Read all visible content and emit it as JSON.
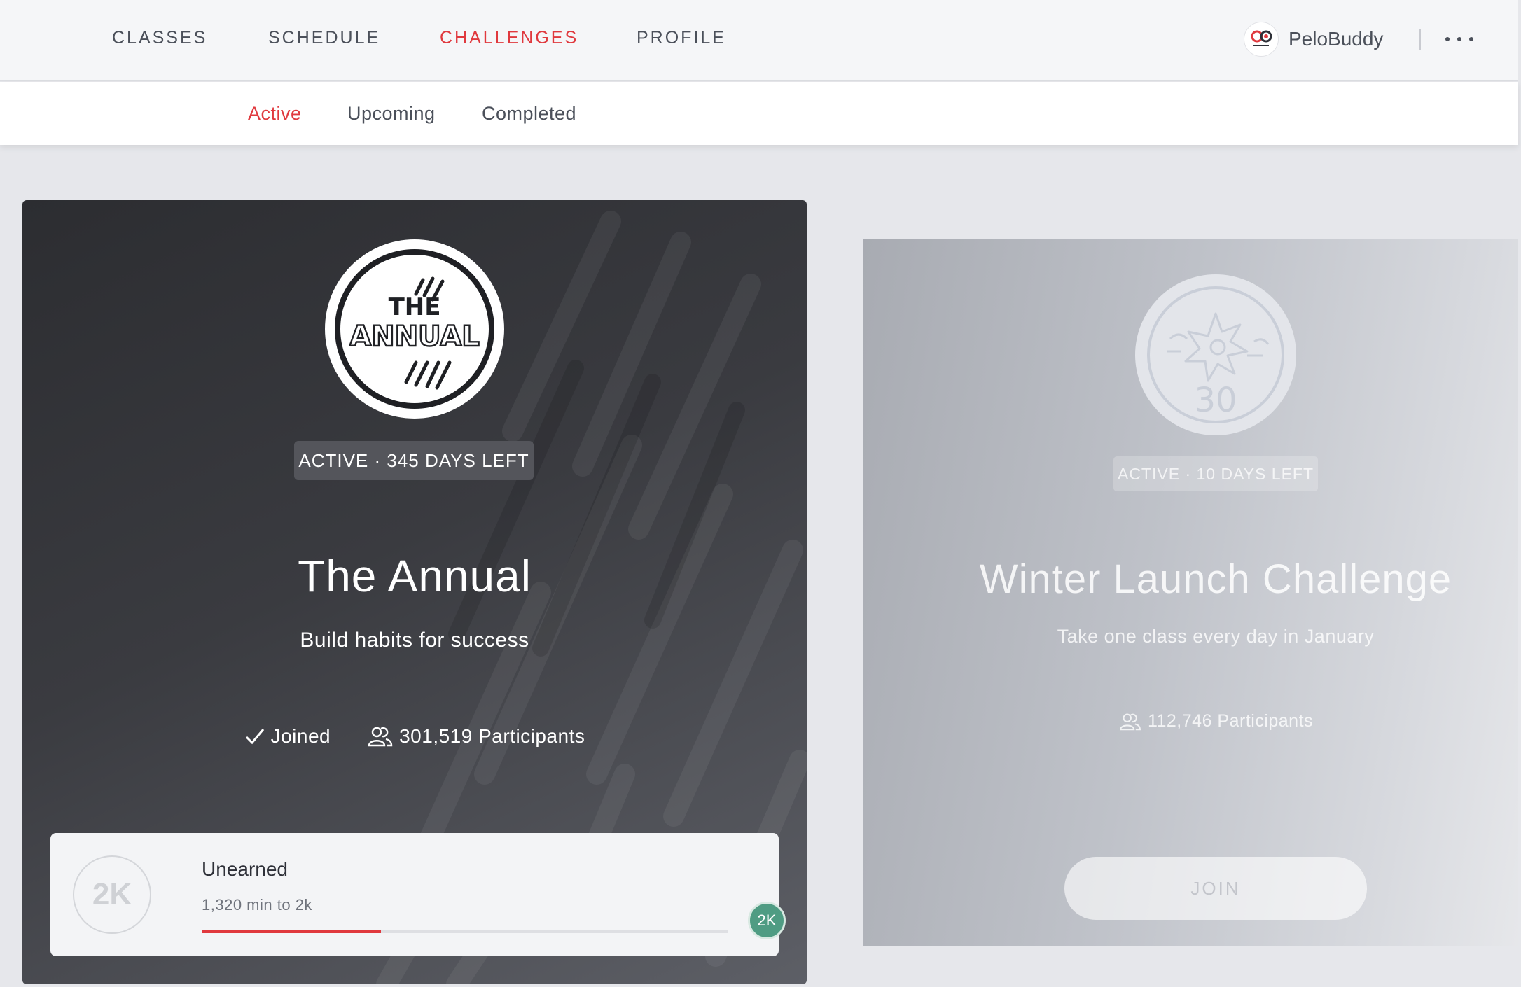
{
  "nav": {
    "items": [
      {
        "label": "CLASSES",
        "active": false
      },
      {
        "label": "SCHEDULE",
        "active": false
      },
      {
        "label": "CHALLENGES",
        "active": true
      },
      {
        "label": "PROFILE",
        "active": false
      }
    ],
    "username": "PeloBuddy",
    "logo_icon": "pelobuddy-logo-icon",
    "more_icon": "more-horizontal-icon"
  },
  "subnav": {
    "tabs": [
      {
        "label": "Active",
        "active": true
      },
      {
        "label": "Upcoming",
        "active": false
      },
      {
        "label": "Completed",
        "active": false
      }
    ]
  },
  "challenges": [
    {
      "badge_line1": "THE",
      "badge_line2": "ANNUAL",
      "status": "ACTIVE · 345 DAYS LEFT",
      "title": "The Annual",
      "subtitle": "Build habits for success",
      "joined_label": "Joined",
      "participants": "301,519 Participants",
      "progress": {
        "badge_text": "2K",
        "title": "Unearned",
        "subtitle": "1,320 min to 2k",
        "fraction": 0.34,
        "goal_text": "2K"
      }
    },
    {
      "badge_number": "30",
      "status": "ACTIVE · 10 DAYS LEFT",
      "title": "Winter Launch Challenge",
      "subtitle": "Take one class every day in January",
      "participants": "112,746 Participants",
      "join_label": "JOIN"
    }
  ],
  "colors": {
    "accent": "#e0393e",
    "goal_badge": "#4f9c83",
    "nav_text": "#4b505a"
  }
}
